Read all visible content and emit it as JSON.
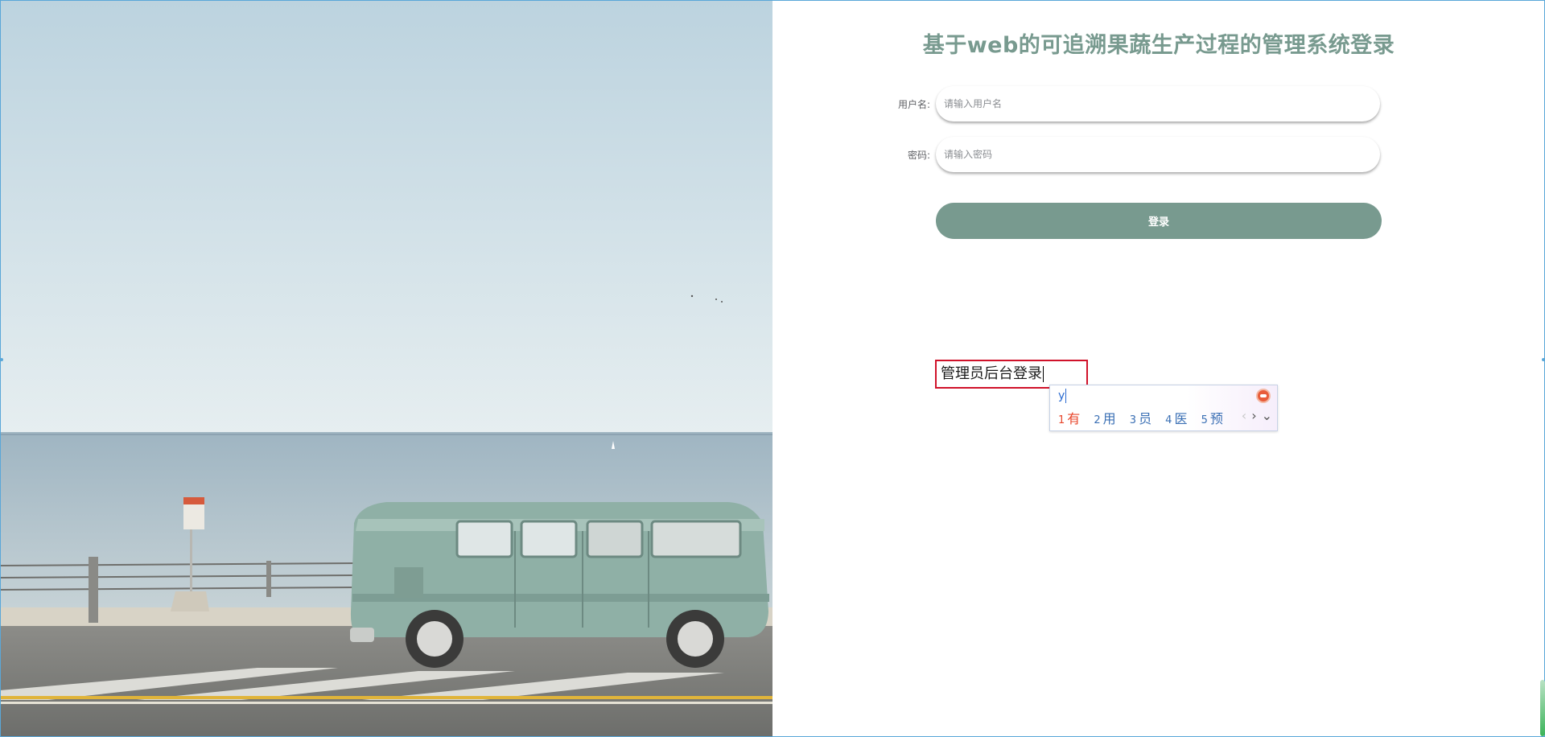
{
  "login": {
    "title": "基于web的可追溯果蔬生产过程的管理系统登录",
    "username_label": "用户名:",
    "username_placeholder": "请输入用户名",
    "password_label": "密码:",
    "password_placeholder": "请输入密码",
    "submit_label": "登录",
    "admin_text": "管理员后台登录"
  },
  "ime": {
    "input": "y",
    "candidates": [
      {
        "num": "1",
        "text": "有"
      },
      {
        "num": "2",
        "text": "用"
      },
      {
        "num": "3",
        "text": "员"
      },
      {
        "num": "4",
        "text": "医"
      },
      {
        "num": "5",
        "text": "预"
      }
    ],
    "nav_prev_icon": "chevron-left-icon",
    "nav_next_icon": "chevron-right-icon",
    "expand_icon": "chevron-down-icon"
  },
  "colors": {
    "accent": "#789a8f",
    "highlight_border": "#d0122a",
    "ime_first": "#e8452a",
    "ime_text": "#3a6fb4"
  }
}
